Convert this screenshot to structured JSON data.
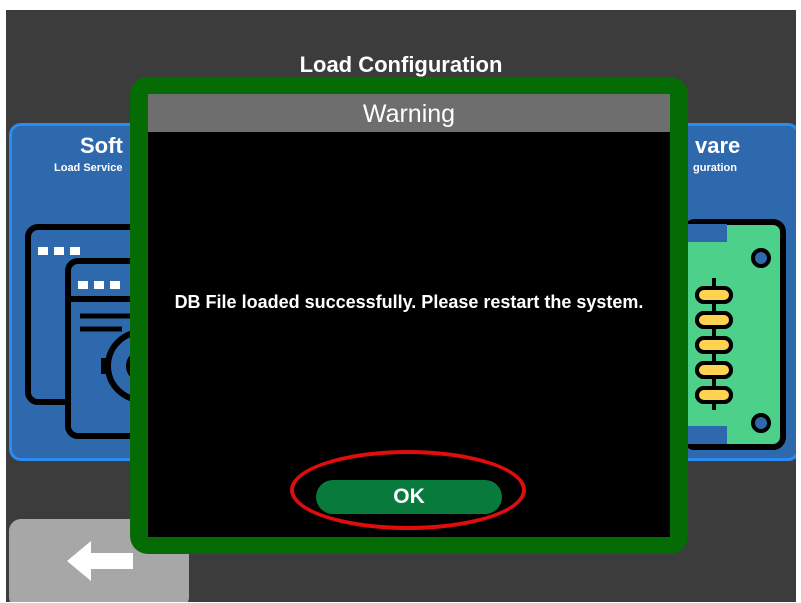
{
  "screen": {
    "title": "Load Configuration"
  },
  "cards": {
    "software": {
      "title": "Soft",
      "subtitle": "Load Service",
      "icon": "software-window-gear-icon"
    },
    "hardware": {
      "title": "vare",
      "subtitle": "guration",
      "icon": "circuit-board-icon"
    }
  },
  "back_button": {
    "icon": "arrow-left-icon"
  },
  "dialog": {
    "title": "Warning",
    "message": "DB File loaded successfully. Please restart the system.",
    "ok_label": "OK"
  },
  "colors": {
    "screen_bg": "#3c3c3c",
    "card_bg": "#2f69ad",
    "card_border": "#2a8cf0",
    "dialog_frame": "#056c05",
    "dialog_header": "#6e6e6e",
    "ok_button": "#087a3c",
    "highlight": "#e10d0d",
    "board_green": "#4cd08a",
    "component_yellow": "#ffd250"
  }
}
